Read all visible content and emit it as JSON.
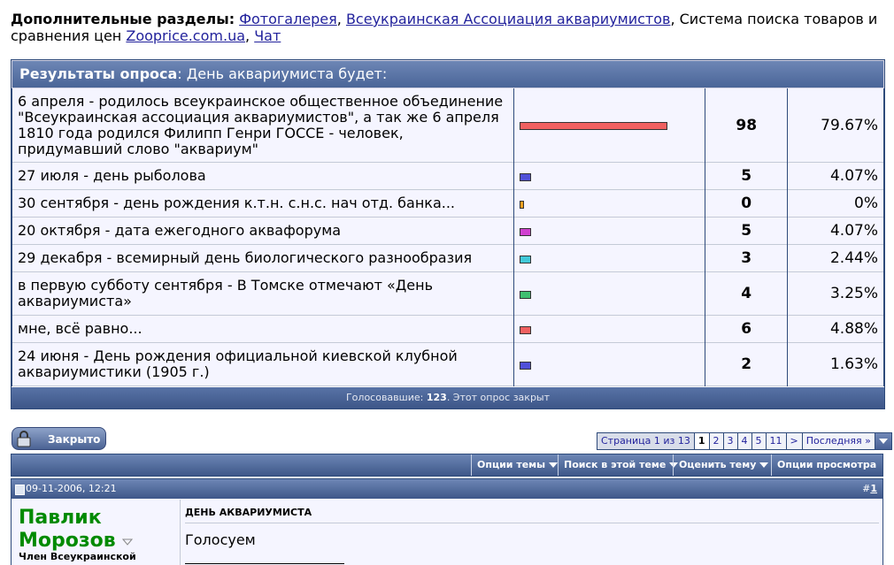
{
  "extra_sections": {
    "label": "Дополнительные разделы:",
    "link_gallery": "Фотогалерея",
    "sep1": ",",
    "link_association": "Всеукраинская Ассоциация аквариумистов",
    "text_search": ", Система поиска товаров и сравнения цен",
    "link_zooprice": "Zooprice.com.ua",
    "sep2": ",",
    "link_chat": "Чат"
  },
  "poll": {
    "head_label": "Результаты опроса",
    "head_question": ": День аквариумиста будет:",
    "options": [
      {
        "text": "6 апреля - родилось всеукраинское общественное объединение \"Всеукраинская ассоциация аквариумистов\", а так же 6 апреля 1810 года родился Филипп Генри ГОССЕ - человек, придумавший слово \"аквариум\"",
        "votes": "98",
        "percent": "79.67%",
        "fraction": 0.7967,
        "color": "#f06060"
      },
      {
        "text": "27 июля - день рыболова",
        "votes": "5",
        "percent": "4.07%",
        "fraction": 0.0407,
        "color": "#5050d8"
      },
      {
        "text": "30 сентября - день рождения к.т.н. с.н.с. нач отд. банка...",
        "votes": "0",
        "percent": "0%",
        "fraction": 0.0,
        "color": "#f0a020"
      },
      {
        "text": "20 октября - дата ежегодного аквафорума",
        "votes": "5",
        "percent": "4.07%",
        "fraction": 0.0407,
        "color": "#d040d0"
      },
      {
        "text": "29 декабря - всемирный день биологического разнообразия",
        "votes": "3",
        "percent": "2.44%",
        "fraction": 0.0244,
        "color": "#40c8d8"
      },
      {
        "text": "в первую субботу сентября - В Томске отмечают «День аквариумиста»",
        "votes": "4",
        "percent": "3.25%",
        "fraction": 0.0325,
        "color": "#40c070"
      },
      {
        "text": "мне, всё равно...",
        "votes": "6",
        "percent": "4.88%",
        "fraction": 0.0488,
        "color": "#f06060"
      },
      {
        "text": "24 июня - День рождения официальной киевской клубной аквариумистики (1905 г.)",
        "votes": "2",
        "percent": "1.63%",
        "fraction": 0.0163,
        "color": "#5050d8"
      }
    ],
    "footer_label": "Голосовавшие:",
    "footer_count": "123",
    "footer_status": ". Этот опрос закрыт"
  },
  "closed_button": {
    "label": "Закрыто"
  },
  "pager": {
    "info": "Страница 1 из 13",
    "pages": [
      "1",
      "2",
      "3",
      "4",
      "5",
      "11"
    ],
    "next": ">",
    "last": "Последняя »"
  },
  "tools": {
    "thread_options": "Опции темы",
    "search_thread": "Поиск в этой теме",
    "rate_thread": "Оценить тему",
    "view_options": "Опции просмотра"
  },
  "post": {
    "date": "09-11-2006, 12:21",
    "number_prefix": "#",
    "number": "1",
    "username": "Павлик Морозов",
    "user_title": "Член Всеукраинской",
    "title": "ДЕНЬ АКВАРИУМИСТА",
    "text": "Голосуем"
  }
}
